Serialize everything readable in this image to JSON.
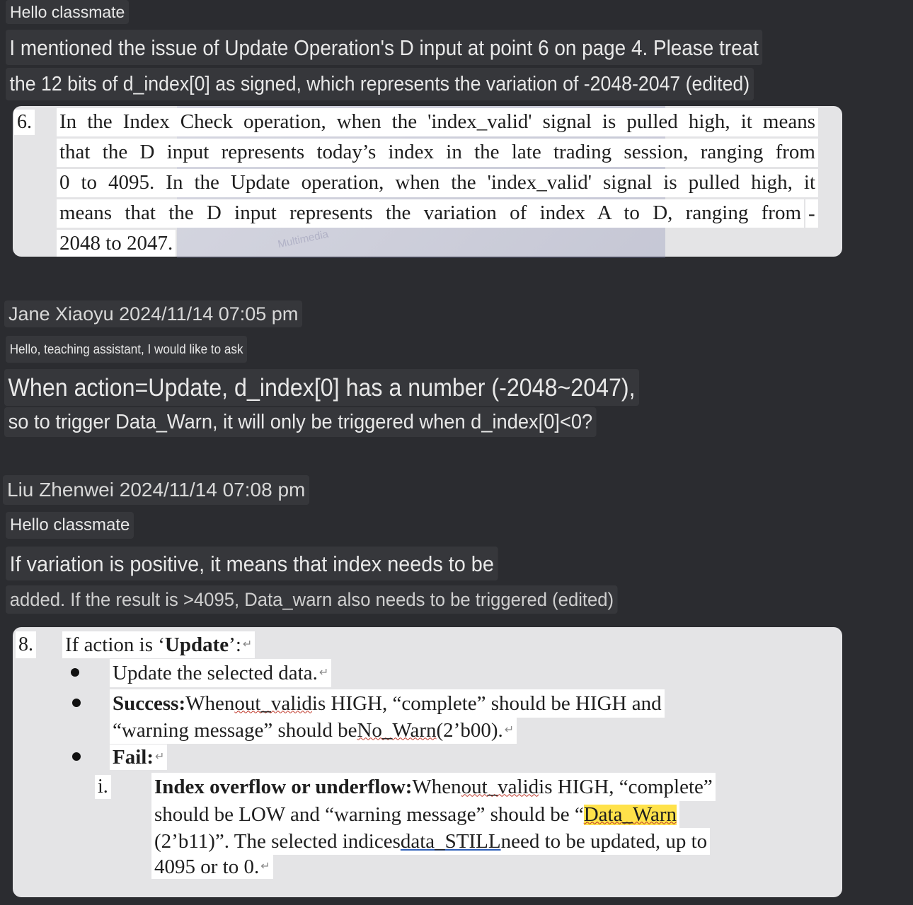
{
  "messages_top": {
    "greeting": "Hello classmate",
    "line1": "I mentioned the issue of Update Operation's D input at point 6 on page 4. Please treat",
    "line2": "the 12 bits of d_index[0] as signed, which represents the variation of -2048-2047 (edited)"
  },
  "doc_point6": {
    "number": "6.",
    "lines": [
      "In the Index Check operation, when the 'index_valid' signal is pulled high, it means",
      "that the D input represents today’s index in the late trading session, ranging from",
      "0 to 4095. In the Update operation, when the 'index_valid' signal is pulled high, it",
      "means that the D input represents the variation of index A to D, ranging from",
      "2048 to 2047."
    ],
    "dash": "-",
    "watermark": "Multimedia"
  },
  "jane": {
    "header": "Jane Xiaoyu 2024/11/14 07:05 pm",
    "intro": "Hello, teaching assistant, I would like to ask",
    "q1": "When action=Update, d_index[0] has a number (-2048~2047),",
    "q2": "so to trigger Data_Warn, it will only be triggered when d_index[0]<0?"
  },
  "liu": {
    "header": "Liu Zhenwei 2024/11/14 07:08 pm",
    "greeting": "Hello classmate",
    "a1": "If variation is positive, it means that index needs to be",
    "a2": "added. If the result is >4095, Data_warn also needs to be triggered (edited)"
  },
  "doc_point8": {
    "number": "8.",
    "title_pre": "If action is ‘",
    "title_bold": "Update",
    "title_post": "’:",
    "b1": "Update the selected data.",
    "b2_bold": "Success:",
    "b2_rest_a": " When ",
    "b2_out": "out_valid",
    "b2_rest_b": " is HIGH, “complete” should be HIGH and",
    "b2_line2_a": "“warning message” should be ",
    "b2_nowarn": "No_Warn",
    "b2_line2_b": " (2’b00).",
    "b3_bold": "Fail:",
    "sub_num": "i.",
    "s1_bold": "Index overflow or underflow:",
    "s1_a": " When ",
    "s1_out": "out_valid",
    "s1_b": " is HIGH, “complete”",
    "s2": "should be LOW and “warning message” should be “",
    "s2_warn": "Data_Warn",
    "s3_a": "(2’b11)”. The selected indices ",
    "s3_link": "data_STILL",
    "s3_b": " need to be updated, up to",
    "s4": "4095 or to 0."
  },
  "return_mark": "↵"
}
